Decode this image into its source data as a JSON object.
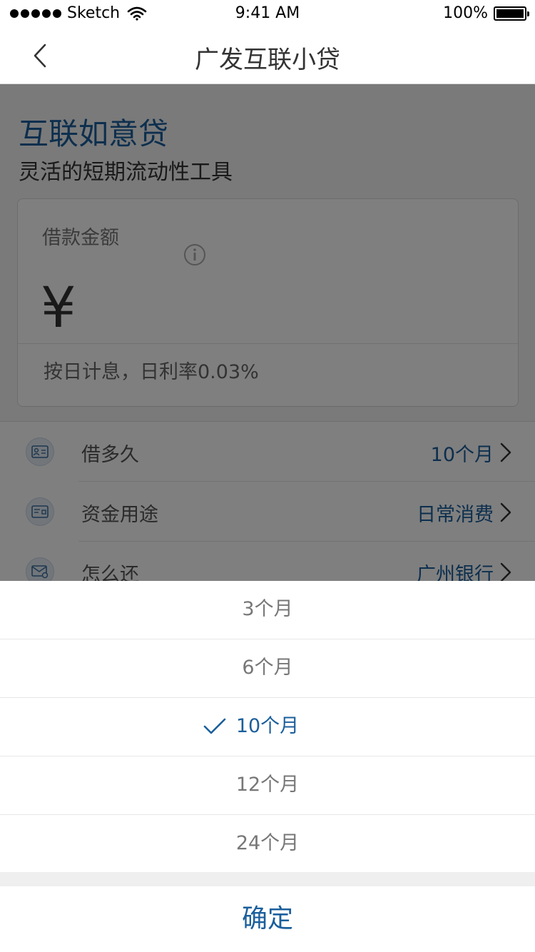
{
  "status_bar": {
    "carrier": "Sketch",
    "time": "9:41 AM",
    "battery": "100%"
  },
  "nav": {
    "title": "广发互联小贷",
    "back_icon": "chevron-left-icon"
  },
  "product": {
    "name": "互联如意贷",
    "subtitle": "灵活的短期流动性工具"
  },
  "amount_card": {
    "label": "借款金额",
    "currency_symbol": "¥",
    "rate_note": "按日计息，日利率0.03%",
    "info_icon": "info-icon"
  },
  "options": [
    {
      "icon": "id-card-icon",
      "label": "借多久",
      "value": "10个月"
    },
    {
      "icon": "card-icon",
      "label": "资金用途",
      "value": "日常消费"
    },
    {
      "icon": "mail-icon",
      "label": "怎么还",
      "value": "广州银行"
    }
  ],
  "picker": {
    "items": [
      {
        "label": "3个月",
        "selected": false
      },
      {
        "label": "6个月",
        "selected": false
      },
      {
        "label": "10个月",
        "selected": true
      },
      {
        "label": "12个月",
        "selected": false
      },
      {
        "label": "24个月",
        "selected": false
      }
    ],
    "confirm_label": "确定"
  },
  "colors": {
    "accent": "#1b5f9c",
    "overlay": "rgba(0,0,0,0.5)"
  }
}
